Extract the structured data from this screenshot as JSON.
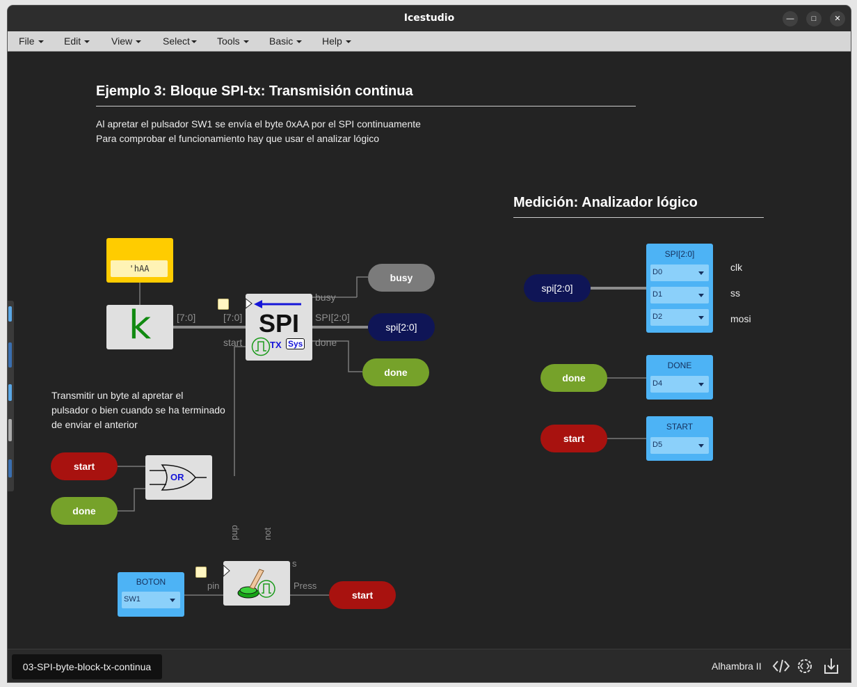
{
  "app": {
    "title": "Icestudio"
  },
  "menu": [
    "File",
    "Edit",
    "View",
    "Select",
    "Tools",
    "Basic",
    "Help"
  ],
  "header": {
    "title": "Ejemplo 3: Bloque SPI-tx: Transmisión continua",
    "line1": "Al apretar el pulsador SW1 se envía el byte 0xAA por el SPI continuamente",
    "line2": "Para comprobar el funcionamiento hay que usar el analizar lógico"
  },
  "measure": {
    "title": "Medición: Analizador lógico"
  },
  "note": {
    "line1": "Transmitir un byte al apretar el",
    "line2": "pulsador o bien cuando se ha terminado",
    "line3": "de enviar el anterior"
  },
  "constant": {
    "value": "'hAA",
    "glyph": "k"
  },
  "spi_block": {
    "label": "SPI",
    "tx": "TX",
    "sys": "Sys",
    "pin_in_data": "[7:0]",
    "pin_start": "start",
    "pin_busy": "busy",
    "pin_spi": "SPI[2:0]",
    "pin_done": "done"
  },
  "const_out_label": "[7:0]",
  "or_gate": {
    "label": "OR"
  },
  "button_block": {
    "pin_pup": "pup",
    "pin_not": "not",
    "pin_s": "s",
    "pin_in": "pin",
    "pin_out": "Press"
  },
  "ports": {
    "busy": "busy",
    "spi_out": "spi[2:0]",
    "done_out": "done",
    "start_in": "start",
    "done_in": "done",
    "start_out": "start",
    "an_spi": "spi[2:0]",
    "an_done": "done",
    "an_start": "start"
  },
  "boton": {
    "title": "BOTON",
    "value": "SW1"
  },
  "analyzer": {
    "spi": {
      "title": "SPI[2:0]",
      "channels": [
        "D0",
        "D1",
        "D2"
      ],
      "labels": [
        "clk",
        "ss",
        "mosi"
      ]
    },
    "done": {
      "title": "DONE",
      "channel": "D4"
    },
    "start": {
      "title": "START",
      "channel": "D5"
    }
  },
  "footer": {
    "file_tab": "03-SPI-byte-block-tx-continua",
    "board": "Alhambra II"
  },
  "icons": [
    "code-icon",
    "verify-icon",
    "upload-icon"
  ],
  "colors": {
    "red_port": "#a8120f",
    "green_port": "#76a22a",
    "navy_port": "#0f1556",
    "grey_port": "#7b7b7b",
    "analyzer": "#4db3f5",
    "constant": "#ffcc00"
  }
}
